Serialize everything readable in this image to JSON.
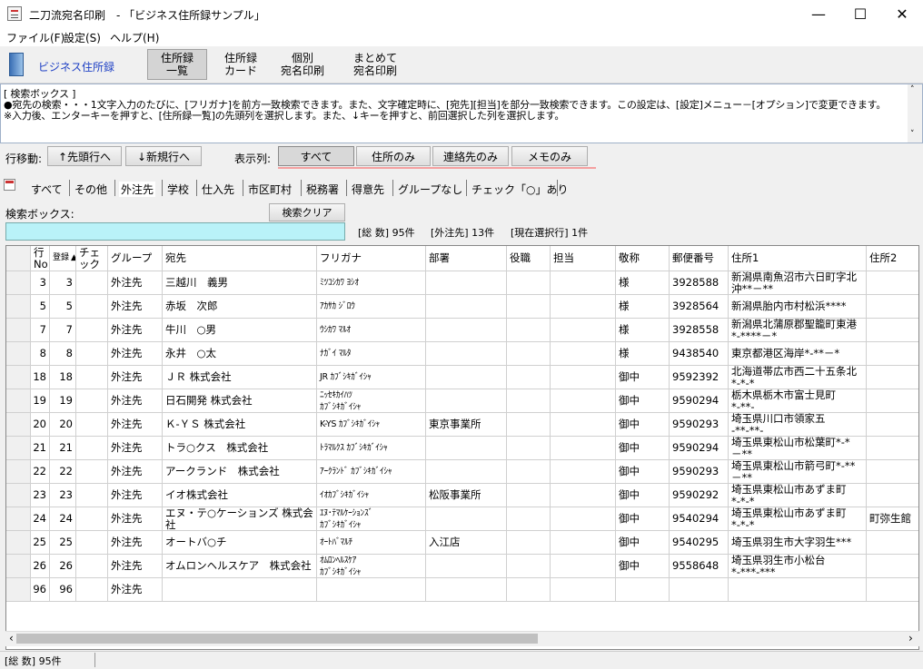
{
  "window": {
    "title": "二刀流宛名印刷　- 「ビジネス住所録サンプル」",
    "minimize": "—",
    "maximize": "☐",
    "close": "✕"
  },
  "menu": [
    "ファイル(F)",
    "設定(S)",
    "ヘルプ(H)"
  ],
  "toolbar": {
    "logo": "ビジネス住所録",
    "buttons": [
      {
        "l1": "住所録",
        "l2": "一覧"
      },
      {
        "l1": "住所録",
        "l2": "カード"
      },
      {
        "l1": "個別",
        "l2": "宛名印刷"
      },
      {
        "l1": "まとめて",
        "l2": "宛名印刷"
      }
    ]
  },
  "help": {
    "heading": "[ 検索ボックス ]",
    "line1": "●宛先の検索・・・1文字入力のたびに、[フリガナ]を前方一致検索できます。また、文字確定時に、[宛先][担当]を部分一致検索できます。この設定は、[設定]メニュー－[オプション]で変更できます。",
    "line2": "※入力後、エンターキーを押すと、[住所録一覧]の先頭列を選択します。また、↓キーを押すと、前回選択した列を選択します。"
  },
  "rowmove": {
    "label": "行移動:",
    "first": "↑先頭行へ",
    "new": "↓新規行へ",
    "display_label": "表示列:",
    "filters": [
      "すべて",
      "住所のみ",
      "連絡先のみ",
      "メモのみ"
    ]
  },
  "tabs": [
    "すべて",
    "その他",
    "外注先",
    "学校",
    "仕入先",
    "市区町村",
    "税務署",
    "得意先",
    "グループなし",
    "チェック「○」あり"
  ],
  "search": {
    "label": "検索ボックス:",
    "clear": "検索クリア",
    "value": "",
    "total": "[総 数] 95件",
    "filtered": "[外注先] 13件",
    "selected": "[現在選択行] 1件"
  },
  "grid": {
    "headers": {
      "row_no_1": "行",
      "row_no_2": "No",
      "reg_no": "登録",
      "check_1": "チェ",
      "check_2": "ック",
      "group": "グループ",
      "name": "宛先",
      "kana": "フリガナ",
      "dept": "部署",
      "title": "役職",
      "person": "担当",
      "honorific": "敬称",
      "zip": "郵便番号",
      "addr1": "住所1",
      "addr2": "住所2"
    },
    "rows": [
      {
        "no": "3",
        "id": "3",
        "group": "外注先",
        "name": "三越川　義男",
        "kana": "ﾐﾂｺｼｶﾜ ﾖｼｵ",
        "kana2": "",
        "dept": "",
        "hon": "様",
        "zip": "3928588",
        "a1": "新潟県南魚沼市六日町字北",
        "a1b": "沖**－**",
        "a2": ""
      },
      {
        "no": "5",
        "id": "5",
        "group": "外注先",
        "name": "赤坂　次郎",
        "kana": "ｱｶｻｶ ｼﾞﾛｳ",
        "kana2": "",
        "dept": "",
        "hon": "様",
        "zip": "3928564",
        "a1": "新潟県胎内市村松浜****",
        "a1b": "",
        "a2": ""
      },
      {
        "no": "7",
        "id": "7",
        "group": "外注先",
        "name": "牛川　○男",
        "kana": "ｳｼｶﾜ ﾏﾙｵ",
        "kana2": "",
        "dept": "",
        "hon": "様",
        "zip": "3928558",
        "a1": "新潟県北蒲原郡聖籠町東港",
        "a1b": "*-****－*",
        "a2": ""
      },
      {
        "no": "8",
        "id": "8",
        "group": "外注先",
        "name": "永井　○太",
        "kana": "ﾅｶﾞｲ ﾏﾙﾀ",
        "kana2": "",
        "dept": "",
        "hon": "様",
        "zip": "9438540",
        "a1": "東京都港区海岸*-**－*",
        "a1b": "",
        "a2": ""
      },
      {
        "no": "18",
        "id": "18",
        "group": "外注先",
        "name": "ＪＲ 株式会社",
        "kana": "JR ｶﾌﾞｼｷｶﾞｲｼｬ",
        "kana2": "",
        "dept": "",
        "hon": "御中",
        "zip": "9592392",
        "a1": "北海道帯広市西二十五条北",
        "a1b": "*-*-*",
        "a2": ""
      },
      {
        "no": "19",
        "id": "19",
        "group": "外注先",
        "name": "日石開発 株式会社",
        "kana": "ﾆｯｾｷｶｲﾊﾂ",
        "kana2": "ｶﾌﾞｼｷｶﾞｲｼｬ",
        "dept": "",
        "hon": "御中",
        "zip": "9590294",
        "a1": "栃木県栃木市富士見町",
        "a1b": "*-**-",
        "a2": ""
      },
      {
        "no": "20",
        "id": "20",
        "group": "外注先",
        "name": "Ｋ-ＹＳ 株式会社",
        "kana": "K-YS ｶﾌﾞｼｷｶﾞｲｼｬ",
        "kana2": "",
        "dept": "東京事業所",
        "hon": "御中",
        "zip": "9590293",
        "a1": "埼玉県川口市領家五",
        "a1b": "-**-**-",
        "a2": ""
      },
      {
        "no": "21",
        "id": "21",
        "group": "外注先",
        "name": "トラ○クス　株式会社",
        "kana": "ﾄﾗﾏﾙｸｽ ｶﾌﾞｼｷｶﾞｲｼｬ",
        "kana2": "",
        "dept": "",
        "hon": "御中",
        "zip": "9590294",
        "a1": "埼玉県東松山市松葉町*-*",
        "a1b": "－**",
        "a2": ""
      },
      {
        "no": "22",
        "id": "22",
        "group": "外注先",
        "name": "アークランド　株式会社",
        "kana": "ｱｰｸﾗﾝﾄﾞ ｶﾌﾞｼｷｶﾞｲｼｬ",
        "kana2": "",
        "dept": "",
        "hon": "御中",
        "zip": "9590293",
        "a1": "埼玉県東松山市箭弓町*-**",
        "a1b": "－**",
        "a2": ""
      },
      {
        "no": "23",
        "id": "23",
        "group": "外注先",
        "name": "イオ株式会社",
        "kana": "ｲｵｶﾌﾞｼｷｶﾞｲｼｬ",
        "kana2": "",
        "dept": "松阪事業所",
        "hon": "御中",
        "zip": "9590292",
        "a1": "埼玉県東松山市あずま町",
        "a1b": "*-*-*",
        "a2": ""
      },
      {
        "no": "24",
        "id": "24",
        "group": "外注先",
        "name": "エヌ・テ○ケーションズ 株式会",
        "name2": "社",
        "kana": "ｴﾇ･ﾃﾏﾙｹｰｼｮﾝｽﾞ",
        "kana2": "ｶﾌﾞｼｷｶﾞｲｼｬ",
        "dept": "",
        "hon": "御中",
        "zip": "9540294",
        "a1": "埼玉県東松山市あずま町",
        "a1b": "*-*-*",
        "a2": "町弥生館"
      },
      {
        "no": "25",
        "id": "25",
        "group": "外注先",
        "name": "オートバ○チ",
        "kana": "ｵｰﾄﾊﾞﾏﾙﾁ",
        "kana2": "",
        "dept": "入江店",
        "hon": "御中",
        "zip": "9540295",
        "a1": "埼玉県羽生市大字羽生***",
        "a1b": "",
        "a2": ""
      },
      {
        "no": "26",
        "id": "26",
        "group": "外注先",
        "name": "オムロンヘルスケア　株式会社",
        "kana": "ｵﾑﾛﾝﾍﾙｽｹｱ",
        "kana2": "ｶﾌﾞｼｷｶﾞｲｼｬ",
        "dept": "",
        "hon": "御中",
        "zip": "9558648",
        "a1": "埼玉県羽生市小松台",
        "a1b": "*-***-***",
        "a2": ""
      },
      {
        "no": "96",
        "id": "96",
        "group": "外注先",
        "name": "",
        "kana": "",
        "kana2": "",
        "dept": "",
        "hon": "",
        "zip": "",
        "a1": "",
        "a1b": "",
        "a2": ""
      }
    ]
  },
  "status": {
    "total": "[総 数] 95件"
  },
  "icons": {
    "sort": "sort-up-arrow-icon",
    "scroll_left": "‹",
    "scroll_right": "›",
    "scroll_up": "˄",
    "scroll_down": "˅"
  }
}
